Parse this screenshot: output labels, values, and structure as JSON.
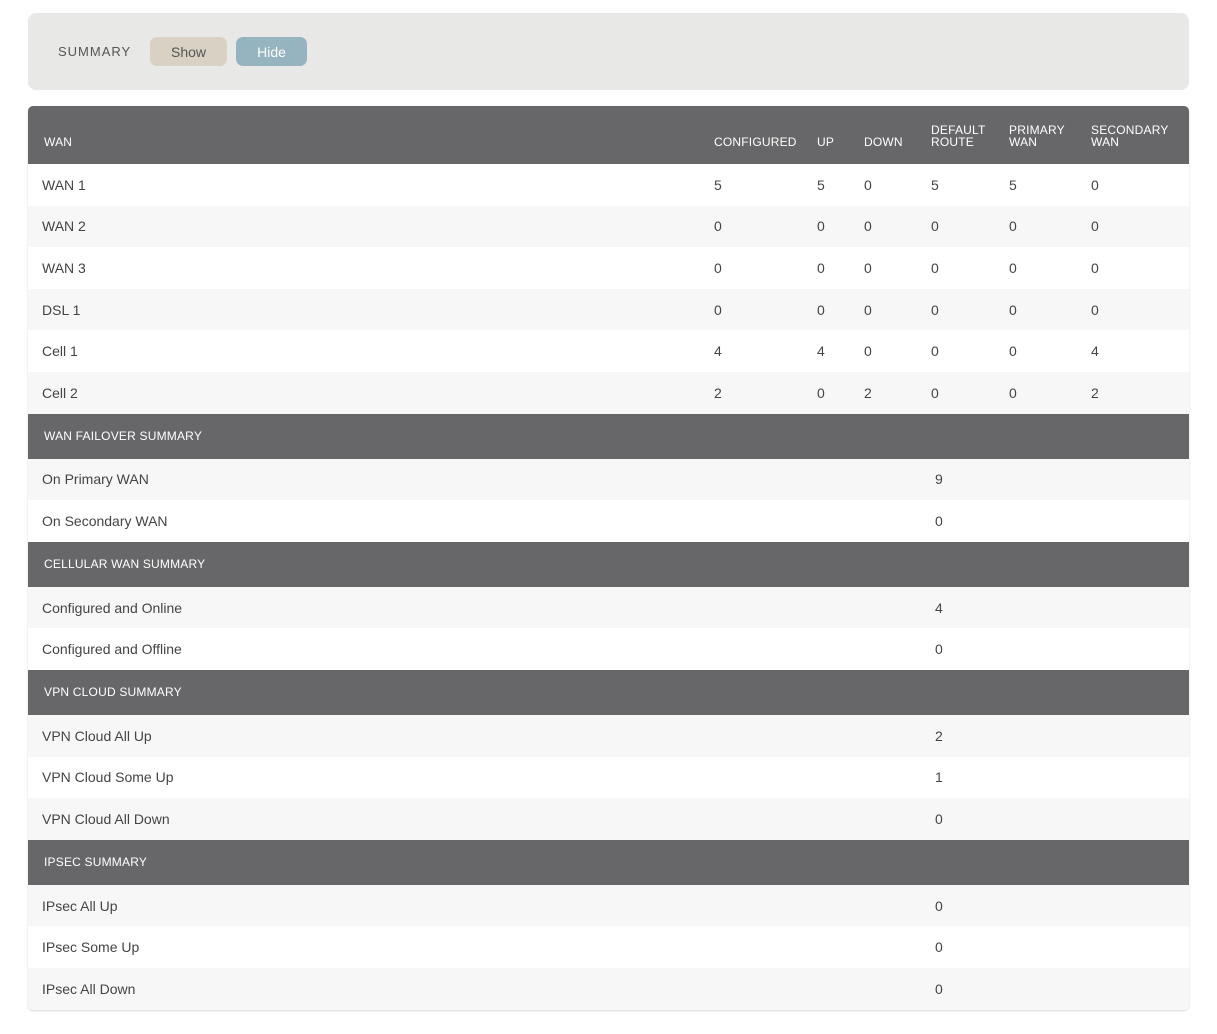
{
  "summary_bar": {
    "label": "SUMMARY",
    "show_label": "Show",
    "hide_label": "Hide"
  },
  "wan_table": {
    "headers": [
      "WAN",
      "CONFIGURED",
      "UP",
      "DOWN",
      "DEFAULT\nROUTE",
      "PRIMARY\nWAN",
      "SECONDARY\nWAN"
    ],
    "rows": [
      {
        "name": "WAN 1",
        "configured": "5",
        "up": "5",
        "down": "0",
        "default_route": "5",
        "primary_wan": "5",
        "secondary_wan": "0"
      },
      {
        "name": "WAN 2",
        "configured": "0",
        "up": "0",
        "down": "0",
        "default_route": "0",
        "primary_wan": "0",
        "secondary_wan": "0"
      },
      {
        "name": "WAN 3",
        "configured": "0",
        "up": "0",
        "down": "0",
        "default_route": "0",
        "primary_wan": "0",
        "secondary_wan": "0"
      },
      {
        "name": "DSL 1",
        "configured": "0",
        "up": "0",
        "down": "0",
        "default_route": "0",
        "primary_wan": "0",
        "secondary_wan": "0"
      },
      {
        "name": "Cell 1",
        "configured": "4",
        "up": "4",
        "down": "0",
        "default_route": "0",
        "primary_wan": "0",
        "secondary_wan": "4"
      },
      {
        "name": "Cell 2",
        "configured": "2",
        "up": "0",
        "down": "2",
        "default_route": "0",
        "primary_wan": "0",
        "secondary_wan": "2"
      }
    ]
  },
  "sections": [
    {
      "title": "WAN FAILOVER SUMMARY",
      "rows": [
        {
          "label": "On Primary WAN",
          "value": "9"
        },
        {
          "label": "On Secondary WAN",
          "value": "0"
        }
      ]
    },
    {
      "title": "CELLULAR WAN SUMMARY",
      "rows": [
        {
          "label": "Configured and Online",
          "value": "4"
        },
        {
          "label": "Configured and Offline",
          "value": "0"
        }
      ]
    },
    {
      "title": "VPN CLOUD SUMMARY",
      "rows": [
        {
          "label": "VPN Cloud All Up",
          "value": "2"
        },
        {
          "label": "VPN Cloud Some Up",
          "value": "1"
        },
        {
          "label": "VPN Cloud All Down",
          "value": "0"
        }
      ]
    },
    {
      "title": "IPSEC SUMMARY",
      "rows": [
        {
          "label": "IPsec All Up",
          "value": "0"
        },
        {
          "label": "IPsec Some Up",
          "value": "0"
        },
        {
          "label": "IPsec All Down",
          "value": "0"
        }
      ]
    }
  ]
}
